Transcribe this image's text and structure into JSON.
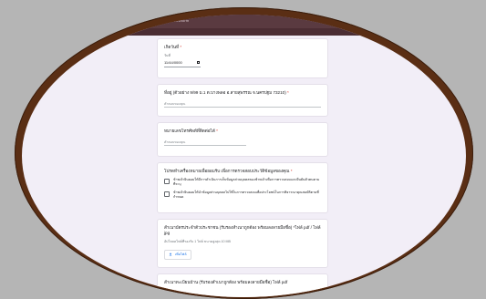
{
  "browser": {
    "url": "docs.google.com/forms/d/e/1FAIpQLSe7t6...../viewform"
  },
  "form": {
    "date_question": {
      "title": "เกิดวันที่",
      "required_mark": "*",
      "sublabel": "วันที่",
      "value": "11/44/0000"
    },
    "address_question": {
      "title": "ที่อยู่ (ตัวอย่าง 9/99 ม.1 ต.บางพลอ อ.สายสุพรรณ จ.นครปฐม 73210)",
      "required_mark": "*",
      "placeholder": "คำตอบของคุณ"
    },
    "phone_question": {
      "title": "หมายเลขโทรศัพท์ที่ติดต่อได้",
      "required_mark": "*",
      "placeholder": "คำตอบของคุณ"
    },
    "consent_question": {
      "title": "โปรดทำเครื่องหมายเพื่อยอมรับ เพื่อการตรวจสอบประวัติข้อมูลของคุณ",
      "required_mark": "*",
      "options": [
        "ข้าพเจ้ายินยอมให้มีการดำเนินการเก็บข้อมูลส่วนบุคคลของข้าพเจ้าเพื่อการตรวจสอบและยืนยันตัวตนตามที่ระบุ",
        "ข้าพเจ้ายินยอมให้นำข้อมูลส่วนบุคคลไปใช้ในการตรวจสอบเพื่อประโยชน์ในการพิจารณาคุณสมบัติตามที่กำหนด"
      ]
    },
    "upload_question": {
      "title": "สำเนาบัตรประจำตัวประชาชน (รับรองสำเนาถูกต้อง พร้อมลงลายมือชื่อ) *ไฟล์ pdf / ไฟล์ jpg",
      "help": "อัปโหลดไฟล์ที่รองรับ 1 ไฟล์ ขนาดสูงสุด 10 MB",
      "button_label": "เพิ่มไฟล์",
      "icons": [
        "upload-icon"
      ]
    },
    "next_question": {
      "title": "สำเนาทะเบียนบ้าน (รับรองสำเนาถูกต้อง พร้อมลงลายมือชื่อ) ไฟล์ pdf"
    }
  },
  "colors": {
    "frame": "#5a2e14",
    "background": "#b5b5b5",
    "form_bg": "#f2eef7",
    "topbar": "#4b2d33",
    "required": "#d93025",
    "link": "#1a73e8"
  }
}
